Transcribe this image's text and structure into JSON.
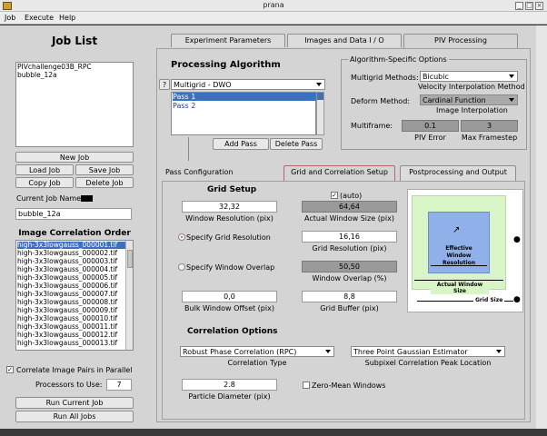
{
  "window": {
    "title": "prana"
  },
  "menu": [
    "Job",
    "Execute",
    "Help"
  ],
  "job_list": {
    "title": "Job List",
    "items": [
      "PIVchallenge03B_RPC",
      "bubble_12a"
    ],
    "buttons": {
      "new": "New Job",
      "load": "Load Job",
      "save": "Save Job",
      "copy": "Copy Job",
      "delete": "Delete Job"
    },
    "current_label": "Current Job Name",
    "current_value": "bubble_12a"
  },
  "image_order": {
    "title": "Image Correlation Order",
    "items": [
      "high-3x3lowgauss_000001.tif",
      "high-3x3lowgauss_000002.tif",
      "high-3x3lowgauss_000003.tif",
      "high-3x3lowgauss_000004.tif",
      "high-3x3lowgauss_000005.tif",
      "high-3x3lowgauss_000006.tif",
      "high-3x3lowgauss_000007.tif",
      "high-3x3lowgauss_000008.tif",
      "high-3x3lowgauss_000009.tif",
      "high-3x3lowgauss_000010.tif",
      "high-3x3lowgauss_000011.tif",
      "high-3x3lowgauss_000012.tif",
      "high-3x3lowgauss_000013.tif"
    ],
    "correlate_pairs": "Correlate Image Pairs in Parallel",
    "processors_label": "Processors to Use:",
    "processors_value": "7",
    "run_current": "Run Current Job",
    "run_all": "Run All Jobs"
  },
  "tabs": [
    "Experiment Parameters",
    "Images and Data I / O",
    "PIV Processing"
  ],
  "processing": {
    "title": "Processing Algorithm",
    "help": "?",
    "algorithm": "Multigrid - DWO",
    "passes": [
      "Pass 1",
      "Pass 2"
    ],
    "add_pass": "Add Pass",
    "delete_pass": "Delete Pass"
  },
  "algo_options": {
    "title": "Algorithm-Specific Options",
    "multigrid_label": "Multigrid Methods:",
    "multigrid_value": "Bicubic",
    "velocity_interp": "Velocity Interpolation Method",
    "deform_label": "Deform Method:",
    "deform_value": "Cardinal Function",
    "image_interp": "Image Interpolation",
    "multiframe_label": "Multiframe:",
    "piv_error_value": "0.1",
    "piv_error_label": "PIV Error",
    "max_framestep_value": "3",
    "max_framestep_label": "Max Framestep"
  },
  "pass_config": {
    "title": "Pass Configuration",
    "subtabs": [
      "Grid and Correlation Setup",
      "Postprocessing and Output"
    ]
  },
  "grid": {
    "title": "Grid Setup",
    "auto_label": "(auto)",
    "window_resolution_value": "32,32",
    "window_resolution_label": "Window Resolution (pix)",
    "actual_window_value": "64,64",
    "actual_window_label": "Actual Window Size (pix)",
    "specify_grid_label": "Specify Grid Resolution",
    "grid_resolution_value": "16,16",
    "grid_resolution_label": "Grid Resolution (pix)",
    "specify_overlap_label": "Specify Window Overlap",
    "window_overlap_value": "50,50",
    "window_overlap_label": "Window Overlap (%)",
    "bulk_offset_value": "0,0",
    "bulk_offset_label": "Bulk Window Offset (pix)",
    "grid_buffer_value": "8,8",
    "grid_buffer_label": "Grid Buffer (pix)"
  },
  "diagram": {
    "effective_label": "Effective Window Resolution",
    "actual_label": "Actual Window Size",
    "grid_size_label": "Grid Size",
    "colors": {
      "outer": "#d8f5c8",
      "inner": "#8fb0e8"
    }
  },
  "correlation": {
    "title": "Correlation Options",
    "type_value": "Robust Phase Correlation (RPC)",
    "type_label": "Correlation Type",
    "subpixel_value": "Three Point Gaussian Estimator",
    "subpixel_label": "Subpixel Correlation Peak Location",
    "particle_value": "2.8",
    "particle_label": "Particle Diameter (pix)",
    "zero_mean_label": "Zero-Mean Windows"
  }
}
